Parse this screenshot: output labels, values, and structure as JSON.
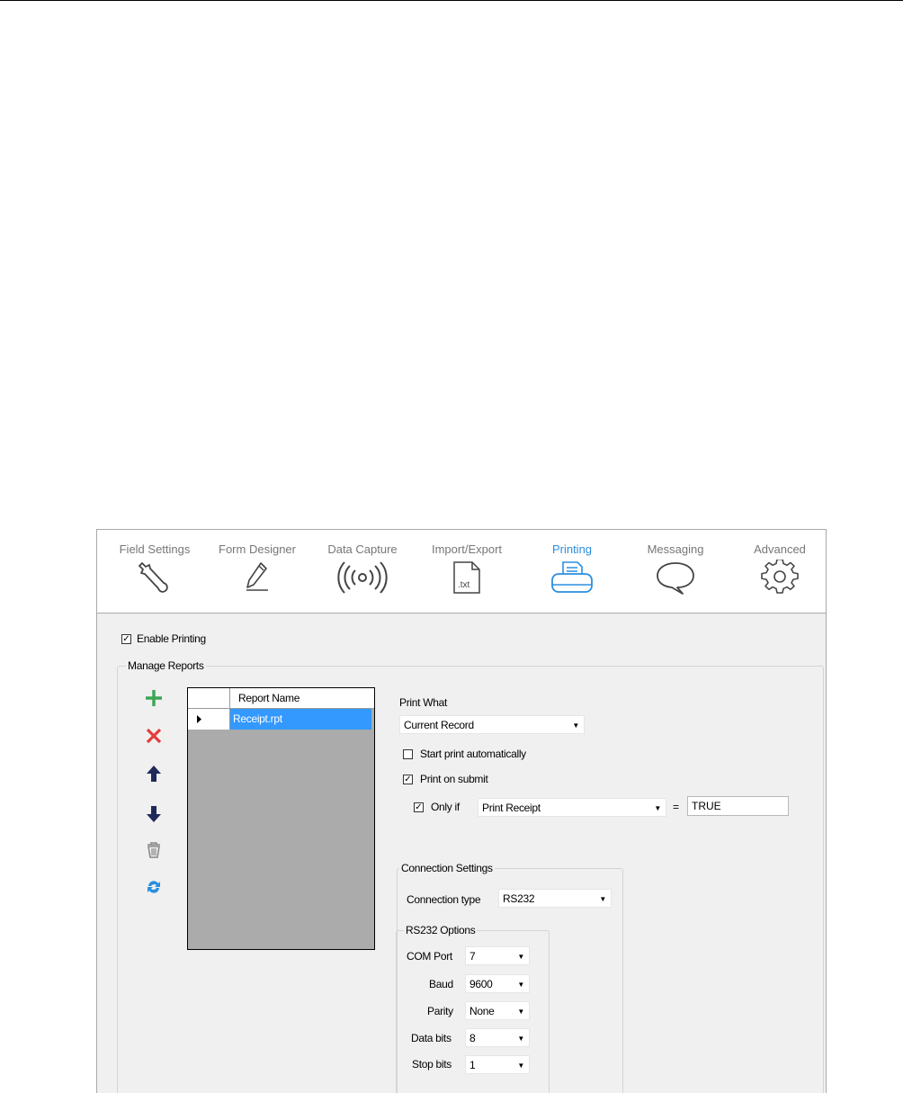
{
  "tabs": [
    {
      "label": "Field Settings",
      "icon": "wrench-icon"
    },
    {
      "label": "Form Designer",
      "icon": "pencil-icon"
    },
    {
      "label": "Data Capture",
      "icon": "radio-waves-icon"
    },
    {
      "label": "Import/Export",
      "icon": "txt-file-icon",
      "icon_text": ".txt"
    },
    {
      "label": "Printing",
      "icon": "printer-icon",
      "active": true
    },
    {
      "label": "Messaging",
      "icon": "speech-bubble-icon"
    },
    {
      "label": "Advanced",
      "icon": "gear-icon"
    }
  ],
  "enable_printing": {
    "label": "Enable Printing",
    "checked": true
  },
  "manage_reports": {
    "legend": "Manage Reports",
    "toolbar": [
      "add-icon",
      "delete-icon",
      "move-up-icon",
      "move-down-icon",
      "trash-icon",
      "refresh-icon"
    ],
    "grid": {
      "column_header": "Report Name",
      "rows": [
        {
          "name": "Receipt.rpt",
          "selected": true
        }
      ]
    }
  },
  "print_what": {
    "label": "Print What",
    "value": "Current Record"
  },
  "start_print": {
    "label": "Start print automatically",
    "checked": false
  },
  "print_on_submit": {
    "label": "Print on submit",
    "checked": true
  },
  "only_if": {
    "label": "Only if",
    "checked": true,
    "field": "Print Receipt",
    "equals": "=",
    "value": "TRUE"
  },
  "connection": {
    "legend": "Connection Settings",
    "type_label": "Connection type",
    "type_value": "RS232",
    "rs232": {
      "legend": "RS232 Options",
      "com_port_label": "COM Port",
      "com_port": "7",
      "baud_label": "Baud",
      "baud": "9600",
      "parity_label": "Parity",
      "parity": "None",
      "data_bits_label": "Data bits",
      "data_bits": "8",
      "stop_bits_label": "Stop bits",
      "stop_bits": "1"
    }
  },
  "colors": {
    "accent": "#2a8fe0",
    "selection": "#3399ff",
    "add": "#3aa655",
    "delete": "#e23c3c",
    "arrow": "#1f2a5a"
  }
}
